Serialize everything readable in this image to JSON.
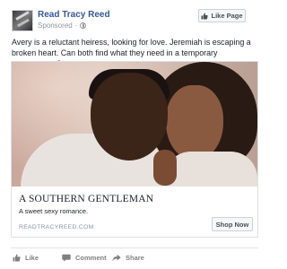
{
  "header": {
    "page_name": "Read Tracy Reed",
    "sponsored_label": "Sponsored",
    "separator": "·",
    "like_page_label": "Like Page"
  },
  "post": {
    "text": "Avery is a reluctant heiress, looking for love. Jeremiah is escaping a broken heart. Can both find what they need in a temporary arrangement?"
  },
  "link_card": {
    "title": "A SOUTHERN GENTLEMAN",
    "description": "A sweet sexy romance.",
    "domain": "READTRACYREED.COM",
    "cta_label": "Shop Now"
  },
  "actions": {
    "like_label": "Like",
    "comment_label": "Comment",
    "share_label": "Share"
  },
  "colors": {
    "page_name": "#365899",
    "meta_text": "#90949c",
    "button_bg": "#f6f7f9",
    "action_text": "#7f7f7f"
  },
  "icons": {
    "globe": "globe-icon",
    "thumb": "thumbs-up-icon",
    "comment": "comment-icon",
    "share": "share-icon"
  }
}
